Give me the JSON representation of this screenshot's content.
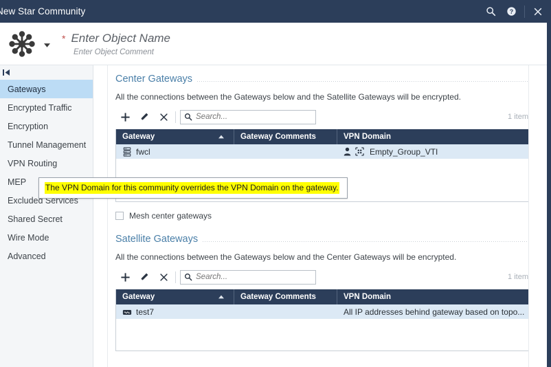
{
  "window": {
    "title": "New Star Community",
    "icons": {
      "search": "search-icon",
      "help": "help-icon",
      "close": "close-icon"
    }
  },
  "object_header": {
    "icon": "star-community-icon",
    "required_marker": "*",
    "name_placeholder": "Enter Object Name",
    "comment_placeholder": "Enter Object Comment",
    "dropdown_caret": "caret-down-icon"
  },
  "sidebar": {
    "collapse_icon": "collapse-panel-icon",
    "items": [
      {
        "label": "Gateways",
        "active": true
      },
      {
        "label": "Encrypted Traffic",
        "active": false
      },
      {
        "label": "Encryption",
        "active": false
      },
      {
        "label": "Tunnel Management",
        "active": false
      },
      {
        "label": "VPN Routing",
        "active": false
      },
      {
        "label": "MEP",
        "active": false
      },
      {
        "label": "Excluded Services",
        "active": false
      },
      {
        "label": "Shared Secret",
        "active": false
      },
      {
        "label": "Wire Mode",
        "active": false
      },
      {
        "label": "Advanced",
        "active": false
      }
    ]
  },
  "center_section": {
    "title": "Center Gateways",
    "description": "All the connections between the Gateways below and the Satellite Gateways will be encrypted.",
    "toolbar": {
      "add_label": "+",
      "edit_label": "edit-icon",
      "delete_label": "×",
      "search_placeholder": "Search...",
      "search_value": "",
      "item_count": "1 item"
    },
    "columns": [
      "Gateway",
      "Gateway Comments",
      "VPN Domain"
    ],
    "sort_column": "Gateway",
    "sort_direction": "ascending",
    "rows": [
      {
        "gateway": "fwcl",
        "gateway_icon": "gateway-cluster-icon",
        "comments": "",
        "vpn_domain": "Empty_Group_VTI",
        "vpn_domain_icons": [
          "user-icon",
          "group-icon"
        ]
      }
    ],
    "checkbox": {
      "label": "Mesh center gateways",
      "checked": false
    }
  },
  "satellite_section": {
    "title": "Satellite Gateways",
    "description": "All the connections between the Gateways below and the Center Gateways will be encrypted.",
    "toolbar": {
      "add_label": "+",
      "edit_label": "edit-icon",
      "delete_label": "×",
      "search_placeholder": "Search...",
      "search_value": "",
      "item_count": "1 item"
    },
    "columns": [
      "Gateway",
      "Gateway Comments",
      "VPN Domain"
    ],
    "sort_column": "Gateway",
    "sort_direction": "ascending",
    "rows": [
      {
        "gateway": "test7",
        "gateway_icon": "gateway-icon",
        "comments": "",
        "vpn_domain": "All IP addresses behind gateway based on topo...",
        "vpn_domain_icons": []
      }
    ]
  },
  "tooltip": {
    "text": "The VPN Domain for this community overrides the VPN Domain on the gateway."
  },
  "colors": {
    "titlebar": "#2c3e5a",
    "table_header": "#2c3e5a",
    "row_selected": "#dce9f5",
    "sidebar_active": "#bcdcf5",
    "section_title": "#4a7fa8",
    "tooltip_highlight": "#ffff00",
    "required_marker": "#c0504d"
  }
}
